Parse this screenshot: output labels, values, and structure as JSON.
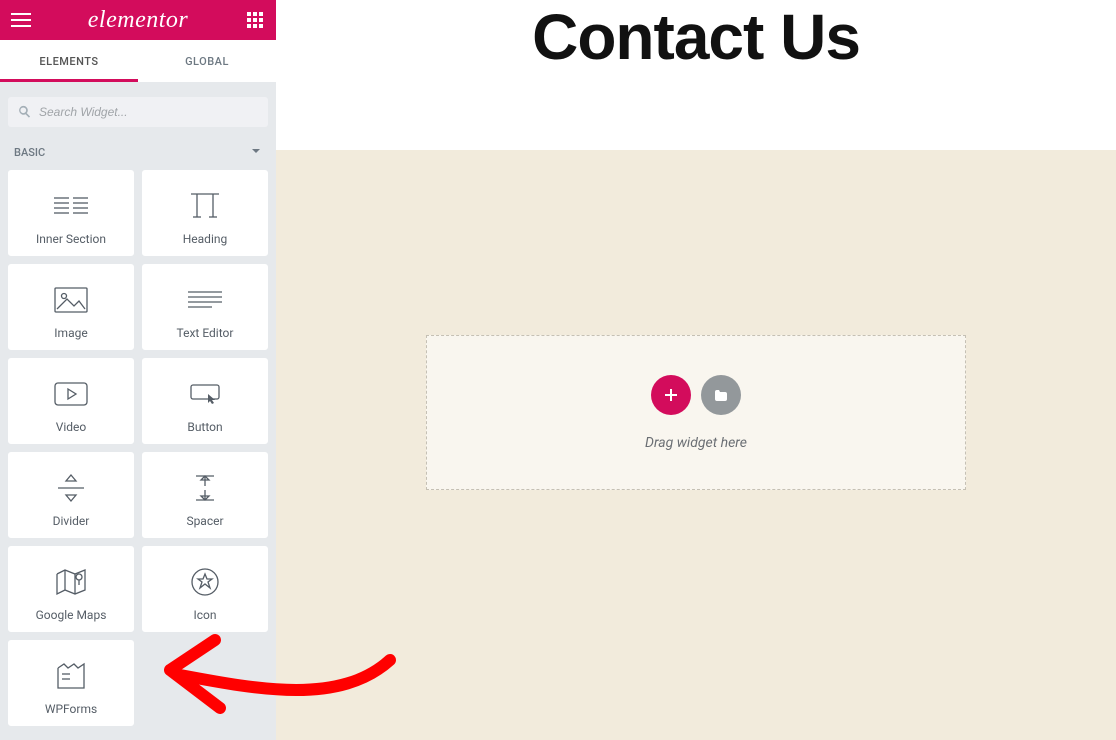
{
  "brand": "elementor",
  "tabs": {
    "elements": "ELEMENTS",
    "global": "GLOBAL"
  },
  "search": {
    "placeholder": "Search Widget..."
  },
  "category": {
    "label": "BASIC"
  },
  "widgets": {
    "inner_section": "Inner Section",
    "heading": "Heading",
    "image": "Image",
    "text_editor": "Text Editor",
    "video": "Video",
    "button": "Button",
    "divider": "Divider",
    "spacer": "Spacer",
    "google_maps": "Google Maps",
    "icon": "Icon",
    "wpforms": "WPForms"
  },
  "page": {
    "title": "Contact Us"
  },
  "dropzone": {
    "hint": "Drag widget here"
  }
}
